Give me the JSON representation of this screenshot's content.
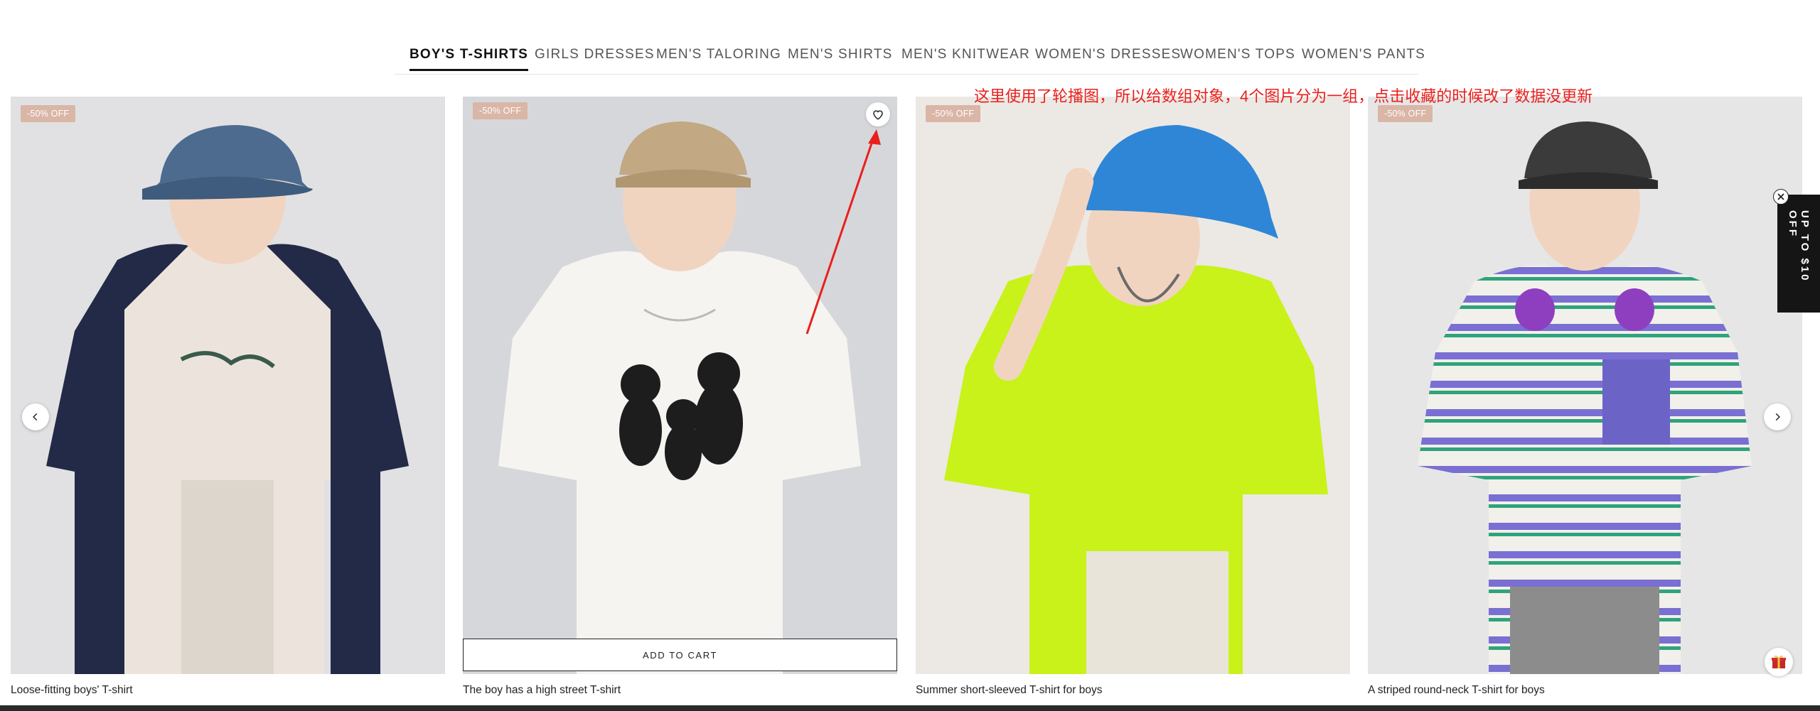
{
  "tabs": [
    {
      "label": "BOY'S T-SHIRTS",
      "active": true
    },
    {
      "label": "GIRLS DRESSES"
    },
    {
      "label": "MEN'S TALORING"
    },
    {
      "label": "MEN'S SHIRTS"
    },
    {
      "label": "MEN'S KNITWEAR"
    },
    {
      "label": "WOMEN'S DRESSES"
    },
    {
      "label": "WOMEN'S TOPS"
    },
    {
      "label": "WOMEN'S PANTS"
    }
  ],
  "products": [
    {
      "badge": "-50% OFF",
      "title": "Loose-fitting boys' T-shirt"
    },
    {
      "badge": "-50% OFF",
      "title": "The boy has a high street T-shirt",
      "add_to_cart": "ADD TO CART"
    },
    {
      "badge": "-50% OFF",
      "title": "Summer short-sleeved T-shirt for boys"
    },
    {
      "badge": "-50% OFF",
      "title": "A striped round-neck T-shirt for boys"
    }
  ],
  "annotation": "这里使用了轮播图，所以给数组对象，4个图片分为一组，点击收藏的时候改了数据没更新",
  "promo": {
    "text": "UP TO $10 OFF"
  },
  "colors": {
    "badge": "#d9b6a6",
    "annotation": "#e8201c",
    "promo_bg": "#151515"
  },
  "icons": {
    "prev": "chevron-left-icon",
    "next": "chevron-right-icon",
    "wishlist": "heart-icon",
    "close": "close-icon",
    "gift": "gift-icon"
  }
}
